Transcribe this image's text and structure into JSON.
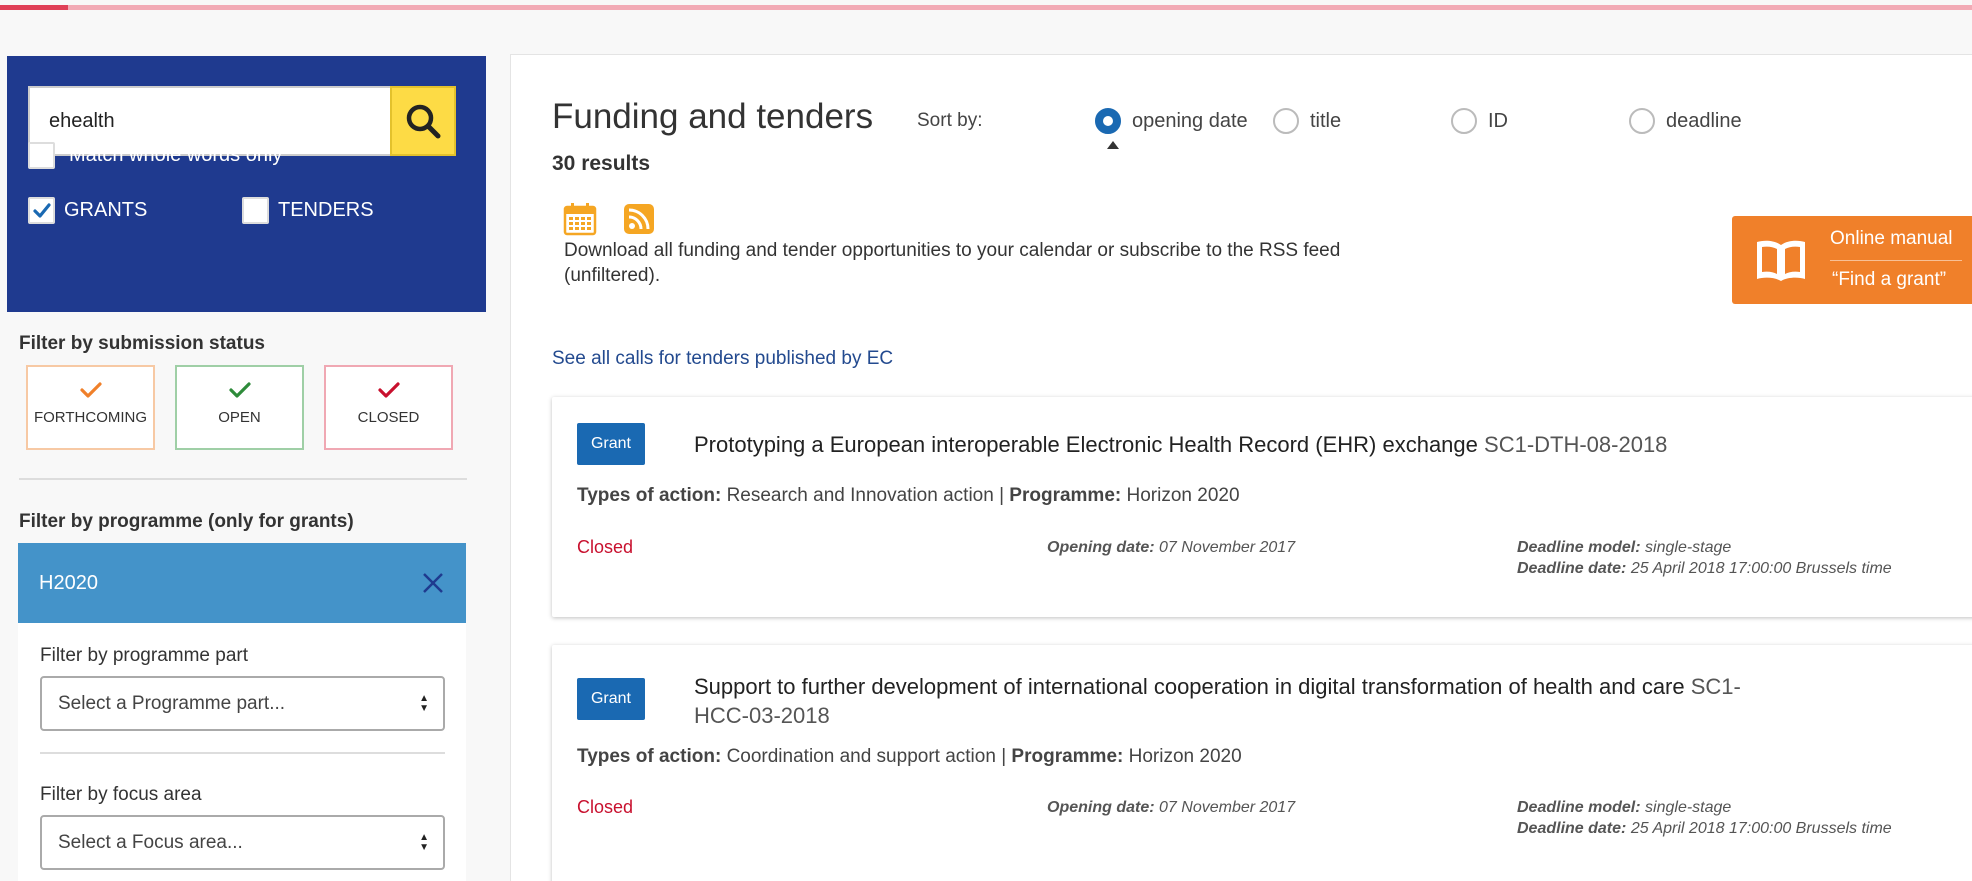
{
  "search": {
    "value": "ehealth",
    "match_whole_words_label": "Match whole words only",
    "grants_label": "GRANTS",
    "tenders_label": "TENDERS"
  },
  "submission_status": {
    "title": "Filter by submission status",
    "options": [
      {
        "label": "FORTHCOMING",
        "color": "#f0802a"
      },
      {
        "label": "OPEN",
        "color": "#2e8b3a"
      },
      {
        "label": "CLOSED",
        "color": "#c8102e"
      }
    ]
  },
  "programme": {
    "title": "Filter by programme (only for grants)",
    "selected": "H2020",
    "part_label": "Filter by programme part",
    "part_placeholder": "Select a Programme part...",
    "focus_label": "Filter by focus area",
    "focus_placeholder": "Select a Focus area..."
  },
  "main": {
    "title": "Funding and tenders",
    "results": "30 results",
    "sort_label": "Sort by:",
    "sort_options": [
      "opening date",
      "title",
      "ID",
      "deadline"
    ],
    "sort_selected": "opening date",
    "download_text": "Download all funding and tender opportunities to your calendar or subscribe to the RSS feed (unfiltered).",
    "manual_line1": "Online manual",
    "manual_line2": "“Find a grant”",
    "see_all_link": "See all calls for tenders published by EC"
  },
  "cards": [
    {
      "badge": "Grant",
      "title": "Prototyping a European interoperable Electronic Health Record (EHR) exchange",
      "id": "SC1-DTH-08-2018",
      "types_label": "Types of action:",
      "types_value": "Research and Innovation action",
      "programme_label": "Programme:",
      "programme_value": "Horizon 2020",
      "status": "Closed",
      "opening_label": "Opening date:",
      "opening_value": "07 November 2017",
      "deadline_model_label": "Deadline model:",
      "deadline_model_value": "single-stage",
      "deadline_date_label": "Deadline date:",
      "deadline_date_value": "25 April 2018 17:00:00 Brussels time"
    },
    {
      "badge": "Grant",
      "title": "Support to further development of international cooperation in digital transformation of health and care",
      "id": "SC1-HCC-03-2018",
      "types_label": "Types of action:",
      "types_value": "Coordination and support action",
      "programme_label": "Programme:",
      "programme_value": "Horizon 2020",
      "status": "Closed",
      "opening_label": "Opening date:",
      "opening_value": "07 November 2017",
      "deadline_model_label": "Deadline model:",
      "deadline_model_value": "single-stage",
      "deadline_date_label": "Deadline date:",
      "deadline_date_value": "25 April 2018 17:00:00 Brussels time"
    }
  ],
  "icons": {
    "search": "search-icon",
    "calendar": "calendar-icon",
    "rss": "rss-icon",
    "manual": "book-icon",
    "close": "close-icon",
    "check": "checkmark-icon",
    "select_arrows": "select-arrows-icon"
  },
  "colors": {
    "sidebar_blue": "#1f3a8f",
    "search_yellow": "#fddb45",
    "chip_blue": "#4493c9",
    "badge_blue": "#1a69b2",
    "manual_orange": "#f0802a",
    "closed_red": "#c8102e",
    "link_blue": "#234a8f"
  }
}
